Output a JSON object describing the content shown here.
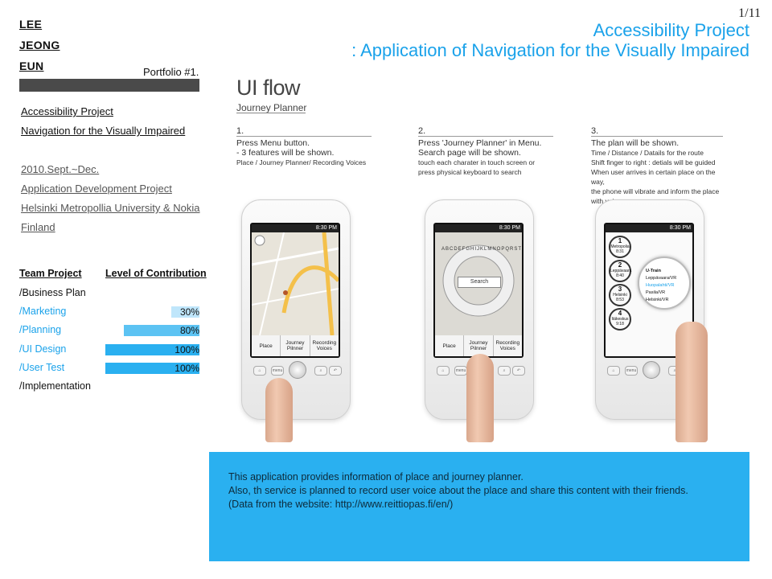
{
  "author": {
    "line1": "LEE",
    "line2": "JEONG ",
    "line3": "EUN"
  },
  "portfolio_label": "Portfolio #1.",
  "project": {
    "name": "Accessibility Project",
    "subtitle": "Navigation for the Visually Impaired"
  },
  "info": {
    "period": "2010.Sept.~Dec.",
    "type": "Application Development Project",
    "org": "Helsinki Metropollia University & Nokia",
    "country": "Finland"
  },
  "team": {
    "head_left": "Team Project",
    "head_right": "Level of Contribution",
    "roles": [
      {
        "label": "/Business Plan",
        "percent_text": "",
        "value": 0
      },
      {
        "label": "/Marketing",
        "percent_text": "30%",
        "value": 30
      },
      {
        "label": "/Planning",
        "percent_text": "80%",
        "value": 80
      },
      {
        "label": "/UI Design",
        "percent_text": "100%",
        "value": 100
      },
      {
        "label": "/User Test",
        "percent_text": "100%",
        "value": 100
      },
      {
        "label": "/Implementation",
        "percent_text": "",
        "value": 0
      }
    ]
  },
  "header": {
    "page_number": "1/11",
    "title_line1": "Accessibility Project",
    "title_line2": ": Application of Navigation for the Visually Impaired"
  },
  "uiflow": {
    "title": "UI flow",
    "subtitle": "Journey Planner"
  },
  "steps": [
    {
      "num": "1.",
      "main": [
        "Press Menu button.",
        "- 3 features will be shown."
      ],
      "small": [
        "Place / Journey Planner/ Recording Voices"
      ]
    },
    {
      "num": "2.",
      "main": [
        "Press 'Journey Planner'  in Menu.",
        "Search page will be shown."
      ],
      "small": [
        "touch each charater in touch screen or",
        "press physical keyboard to search"
      ]
    },
    {
      "num": "3.",
      "main": [
        "The plan will be shown."
      ],
      "small": [
        "Time / Distance / Datails for the route",
        "Shift finger to right : detials will be guided",
        "When user arrives  in certain place on the way,",
        "the phone will vibrate and inform the place",
        "with voice"
      ]
    }
  ],
  "phone": {
    "time": "8:30 PM",
    "softkeys": [
      "Place",
      "Journey Pilnner",
      "Recording Voices"
    ],
    "menu_label": "menu",
    "search_label": "Search",
    "alphabet": "ABCDEFGHIJKLMNOPQRSTUVWXYZ",
    "route_stops": [
      {
        "num": "1",
        "name": "Metropolia",
        "time": "8:31"
      },
      {
        "num": "2",
        "name": "Leppävaara",
        "time": "8:40"
      },
      {
        "num": "3",
        "name": "Helsinki",
        "time": "8:53"
      },
      {
        "num": "4",
        "name": "Itäkeskus",
        "time": "9:18"
      }
    ],
    "popup_title": "U-Train",
    "popup_items": [
      "Leppävaara/VR",
      "Huopalahti/VR",
      "Pasila/VR",
      "Helsinki/VR"
    ]
  },
  "description": {
    "line1": "This application provides information of place and journey planner.",
    "line2": "Also, th service is planned to record user voice about the place and share this content with their friends.",
    "line3": "(Data from the website: http://www.reittiopas.fi/en/)"
  },
  "colors": {
    "accent": "#1aa2ea",
    "bar_light": "#bfe6fb",
    "bar_mid": "#5cc3f3",
    "bar_full": "#2ab0f0",
    "dark_bar": "#4a4a4a",
    "desc_bg": "#2ab0f0"
  }
}
